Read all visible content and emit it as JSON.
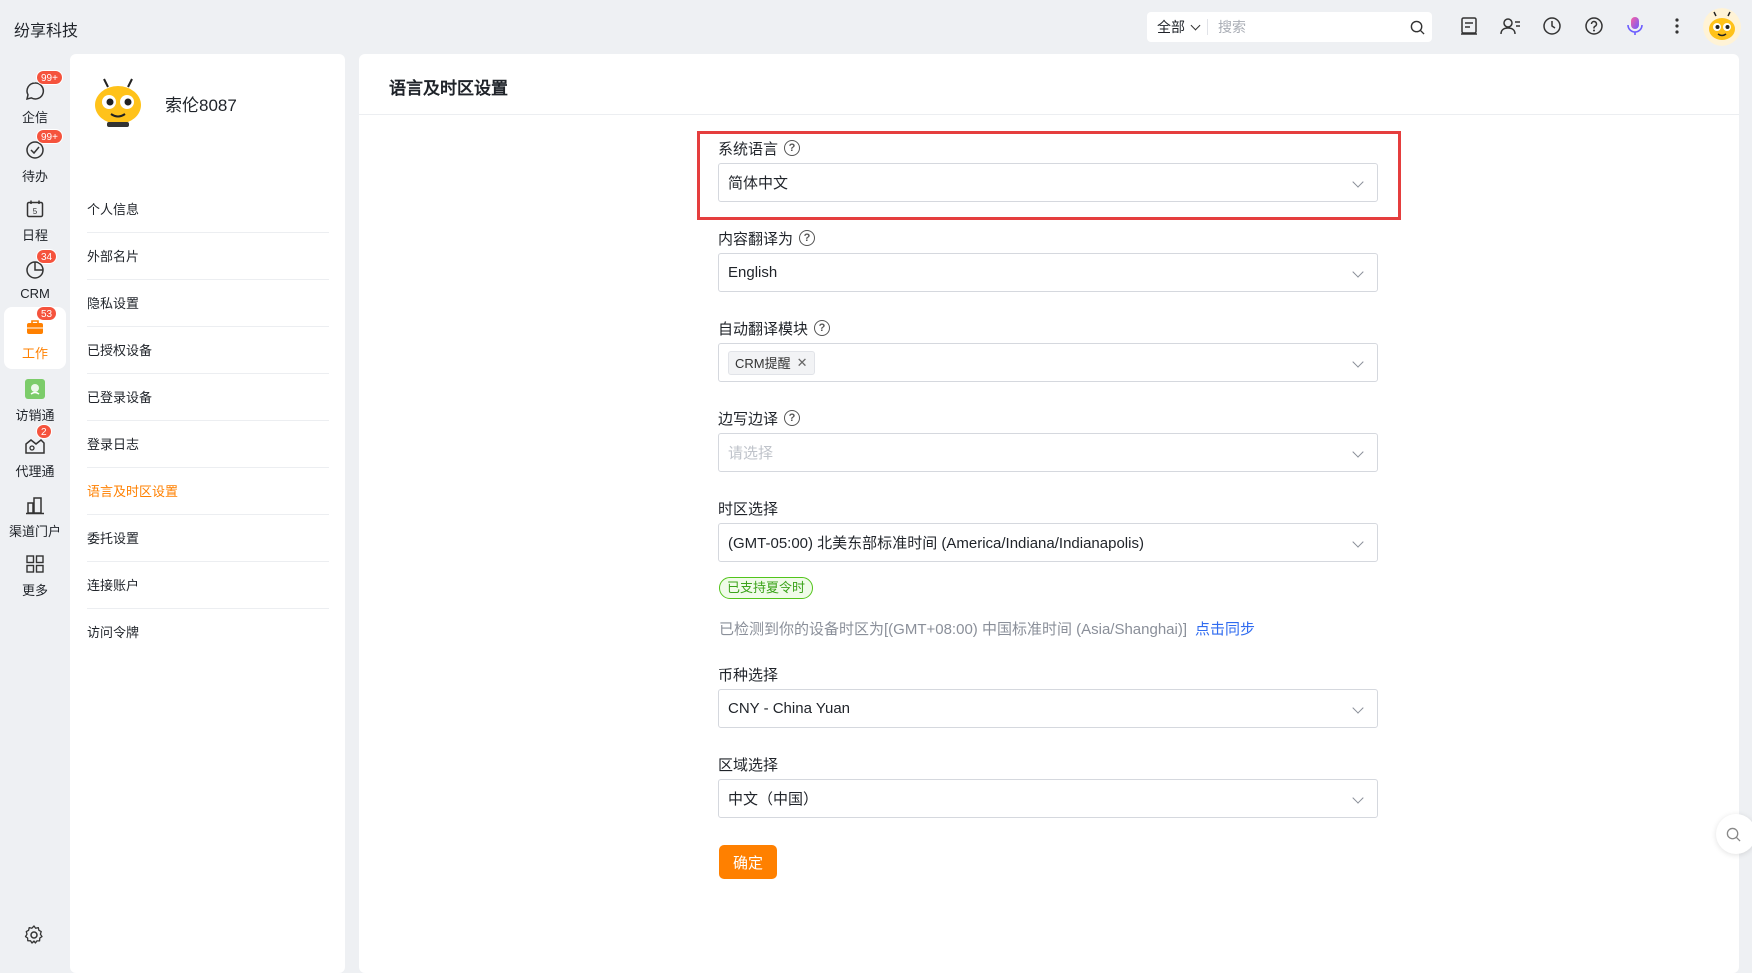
{
  "app": {
    "name": "纷享科技"
  },
  "search": {
    "scope": "全部",
    "placeholder": "搜索"
  },
  "header_icons": [
    "document-icon",
    "contacts-icon",
    "history-clock-icon",
    "help-icon",
    "voice-assistant-icon",
    "more-icon"
  ],
  "rail": {
    "items": [
      {
        "label": "企信",
        "icon": "chat-icon",
        "badge": "99+"
      },
      {
        "label": "待办",
        "icon": "check-circle-icon",
        "badge": "99+"
      },
      {
        "label": "日程",
        "icon": "calendar-icon",
        "badge": "",
        "date": "5"
      },
      {
        "label": "CRM",
        "icon": "pie-chart-icon",
        "badge": "34"
      },
      {
        "label": "工作",
        "icon": "briefcase-icon",
        "badge": "53",
        "active": true
      },
      {
        "label": "访销通",
        "icon": "visit-sales-icon",
        "badge": ""
      },
      {
        "label": "代理通",
        "icon": "agent-icon",
        "badge": "2"
      },
      {
        "label": "渠道门户",
        "icon": "channel-portal-icon",
        "badge": ""
      },
      {
        "label": "更多",
        "icon": "grid-icon",
        "badge": ""
      }
    ]
  },
  "profile": {
    "name": "索伦8087",
    "menu": [
      {
        "label": "个人信息"
      },
      {
        "label": "外部名片"
      },
      {
        "label": "隐私设置"
      },
      {
        "label": "已授权设备"
      },
      {
        "label": "已登录设备"
      },
      {
        "label": "登录日志"
      },
      {
        "label": "语言及时区设置",
        "active": true
      },
      {
        "label": "委托设置"
      },
      {
        "label": "连接账户"
      },
      {
        "label": "访问令牌"
      }
    ]
  },
  "main": {
    "title": "语言及时区设置",
    "fields": {
      "system_language": {
        "label": "系统语言",
        "value": "简体中文"
      },
      "translate_to": {
        "label": "内容翻译为",
        "value": "English"
      },
      "auto_translate": {
        "label": "自动翻译模块",
        "tag": "CRM提醒"
      },
      "side_translate": {
        "label": "边写边译",
        "placeholder": "请选择"
      },
      "timezone": {
        "label": "时区选择",
        "value": "(GMT-05:00) 北美东部标准时间 (America/Indiana/Indianapolis)"
      },
      "currency": {
        "label": "币种选择",
        "value": "CNY - China Yuan"
      },
      "region": {
        "label": "区域选择",
        "value": "中文（中国）"
      }
    },
    "dst_badge": "已支持夏令时",
    "detect_text": "已检测到你的设备时区为[(GMT+08:00) 中国标准时间 (Asia/Shanghai)]",
    "sync_link": "点击同步",
    "confirm_button": "确定"
  },
  "colors": {
    "accent": "#ff8000",
    "link": "#2f6bf0",
    "badge": "#f5533d",
    "highlight": "#e53e3e",
    "dst_green": "#3ba31a"
  }
}
